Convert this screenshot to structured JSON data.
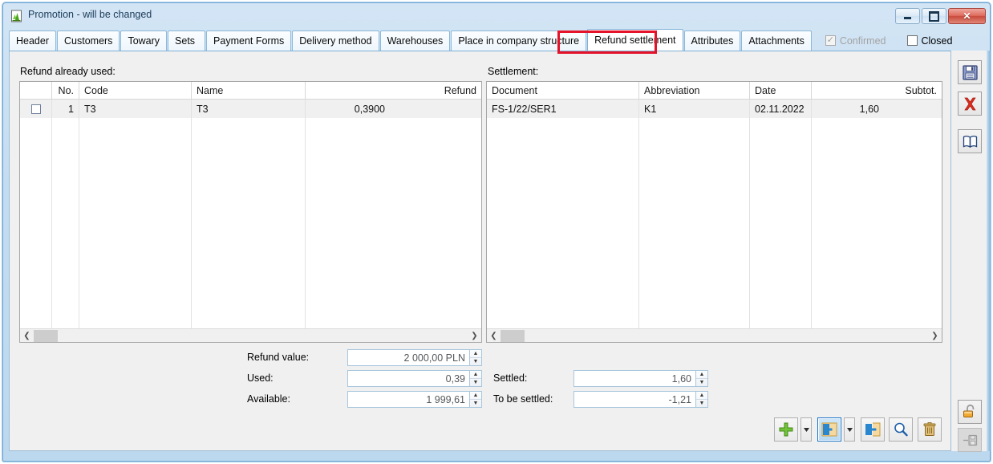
{
  "window": {
    "title": "Promotion - will be changed",
    "icon": "app-icon",
    "controls": {
      "minimize": "minimize-button",
      "maximize": "maximize-button",
      "close": "close-button"
    }
  },
  "tabs": [
    {
      "label": "Header",
      "active": false
    },
    {
      "label": "Customers",
      "active": false
    },
    {
      "label": "Towary",
      "active": false
    },
    {
      "label": "Sets",
      "active": false
    },
    {
      "label": "Payment Forms",
      "active": false
    },
    {
      "label": "Delivery method",
      "active": false
    },
    {
      "label": "Warehouses",
      "active": false
    },
    {
      "label": "Place in company structure",
      "active": false
    },
    {
      "label": "Refund settlement",
      "active": true
    },
    {
      "label": "Attributes",
      "active": false
    },
    {
      "label": "Attachments",
      "active": false
    }
  ],
  "header_checkboxes": [
    {
      "label": "Confirmed",
      "checked": true,
      "disabled": true
    },
    {
      "label": "Closed",
      "checked": false,
      "disabled": false
    }
  ],
  "left_panel": {
    "label": "Refund already used:",
    "columns": [
      "",
      "No.",
      "Code",
      "Name",
      "Refund"
    ],
    "rows": [
      {
        "checked": false,
        "no": "1",
        "code": "T3",
        "name": "T3",
        "refund": "0,3900"
      }
    ]
  },
  "right_panel": {
    "label": "Settlement:",
    "columns": [
      "Document",
      "Abbreviation",
      "Date",
      "Subtot."
    ],
    "rows": [
      {
        "document": "FS-1/22/SER1",
        "abbreviation": "K1",
        "date": "02.11.2022",
        "subtotal": "1,60"
      }
    ]
  },
  "fields": {
    "refund_value": {
      "label": "Refund value:",
      "value": "2 000,00 PLN"
    },
    "used": {
      "label": "Used:",
      "value": "0,39"
    },
    "available": {
      "label": "Available:",
      "value": "1 999,61"
    },
    "settled": {
      "label": "Settled:",
      "value": "1,60"
    },
    "to_be_settled": {
      "label": "To be settled:",
      "value": "-1,21"
    }
  },
  "bottom_toolbar": [
    {
      "name": "add-button",
      "icon": "plus-icon"
    },
    {
      "name": "add-dropdown-button",
      "icon": "chevron-down-icon"
    },
    {
      "name": "open-document-button",
      "icon": "open-door-right-icon",
      "focused": true
    },
    {
      "name": "open-document-dropdown-button",
      "icon": "chevron-down-icon"
    },
    {
      "name": "exit-document-button",
      "icon": "open-door-left-icon"
    },
    {
      "name": "preview-button",
      "icon": "magnifier-icon"
    },
    {
      "name": "delete-button",
      "icon": "trash-icon"
    }
  ],
  "side_toolbar": [
    {
      "name": "save-button",
      "icon": "floppy-disk-icon",
      "disabled": false
    },
    {
      "name": "cancel-button",
      "icon": "red-x-icon",
      "disabled": false
    },
    {
      "name": "help-button",
      "icon": "open-book-icon",
      "disabled": false
    },
    {
      "name": "unlock-button",
      "icon": "open-padlock-icon",
      "disabled": false
    },
    {
      "name": "save-and-close-button",
      "icon": "save-close-icon",
      "disabled": true
    }
  ],
  "colors": {
    "accent": "#7fb0d4",
    "annotation": "#e4132a",
    "panel": "#f0f0f0",
    "row": "#f0f0f0"
  }
}
